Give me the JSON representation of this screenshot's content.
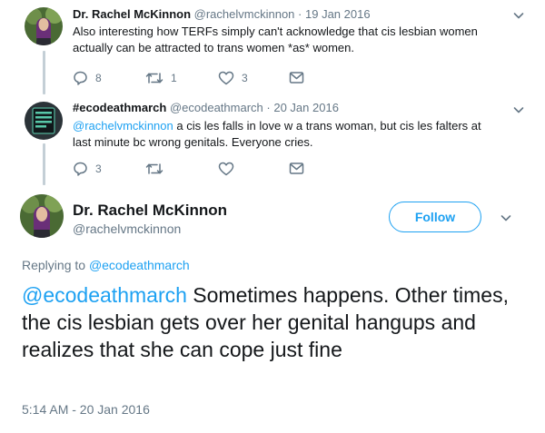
{
  "tweet1": {
    "name": "Dr. Rachel McKinnon",
    "handle": "@rachelvmckinnon",
    "separator": "·",
    "date": "19 Jan 2016",
    "text": "Also interesting how TERFs simply can't acknowledge that cis lesbian women actually can be attracted to trans women *as* women.",
    "reply_count": "8",
    "retweet_count": "1",
    "like_count": "3"
  },
  "tweet2": {
    "name": "#ecodeathmarch",
    "handle": "@ecodeathmarch",
    "separator": "·",
    "date": "20 Jan 2016",
    "mention": "@rachelvmckinnon",
    "text": " a cis les falls in love w a trans woman, but cis les falters at last minute bc wrong genitals. Everyone cries.",
    "reply_count": "3"
  },
  "main_tweet": {
    "name": "Dr. Rachel McKinnon",
    "handle": "@rachelvmckinnon",
    "follow_label": "Follow",
    "replying_label": "Replying to",
    "replying_to": "@ecodeathmarch",
    "mention": "@ecodeathmarch",
    "text": " Sometimes happens. Other times, the cis lesbian gets over her genital hangups and realizes that she can cope just fine",
    "timestamp": "5:14 AM - 20 Jan 2016"
  },
  "icons": {
    "reply": "reply-icon",
    "retweet": "retweet-icon",
    "like": "heart-icon",
    "dm": "envelope-icon",
    "more": "chevron-down-icon"
  },
  "colors": {
    "accent": "#1da1f2",
    "muted": "#657786",
    "thread_line": "#c4cfd6"
  }
}
